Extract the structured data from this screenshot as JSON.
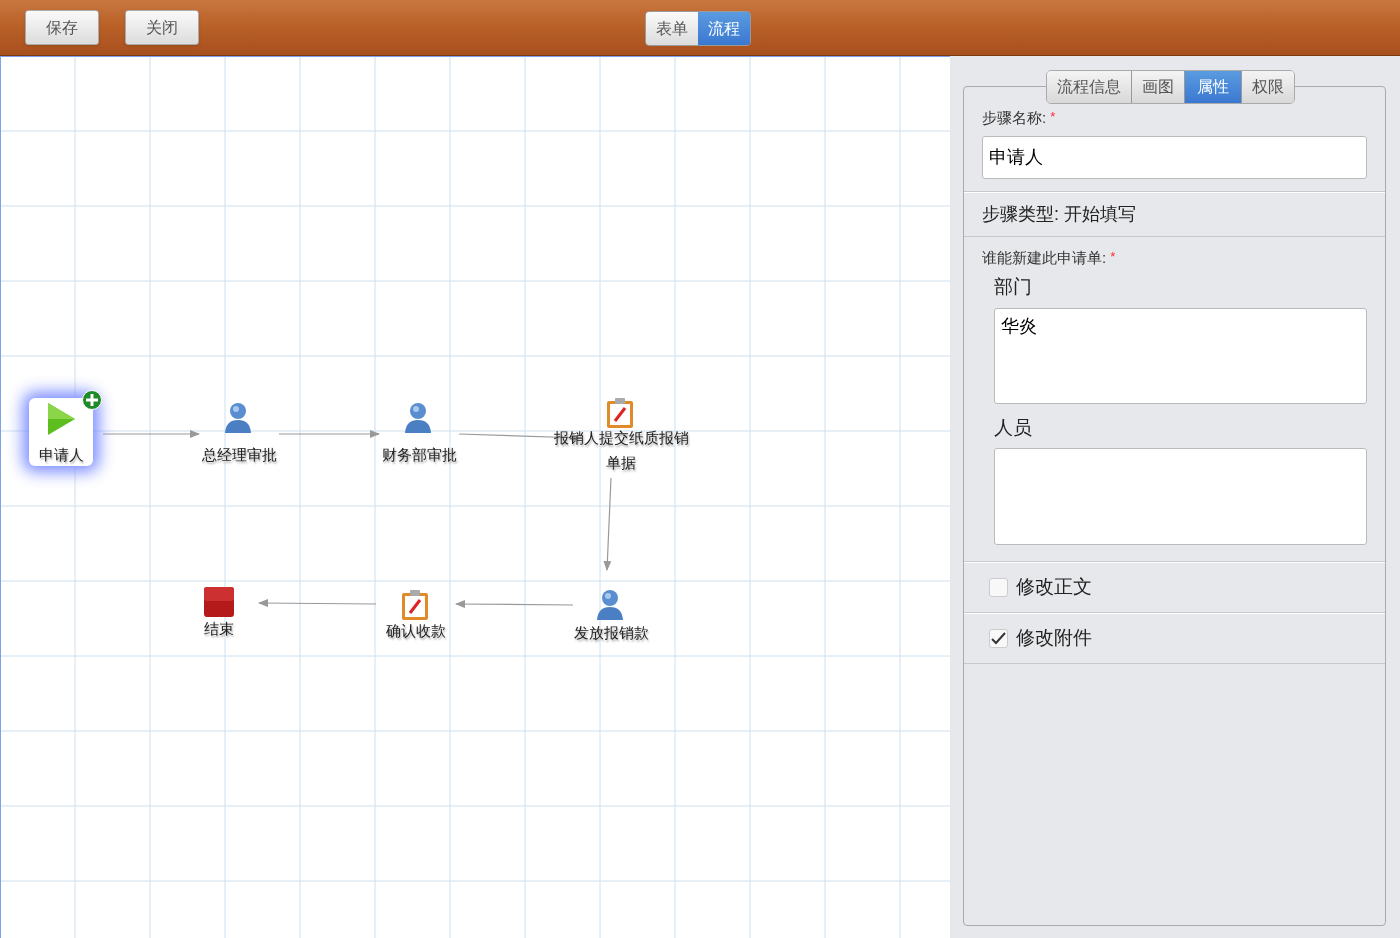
{
  "toolbar": {
    "buttons": [
      "保存",
      "关闭"
    ],
    "view_tabs": [
      {
        "label": "表单",
        "selected": false
      },
      {
        "label": "流程",
        "selected": true
      }
    ]
  },
  "flow": {
    "nodes": [
      {
        "kind": "start",
        "label": "申请人",
        "selected": true
      },
      {
        "kind": "user",
        "label": "总经理审批",
        "selected": false
      },
      {
        "kind": "user",
        "label": "财务部审批",
        "selected": false
      },
      {
        "kind": "task",
        "label": "报销人提交纸质报销单据",
        "selected": false
      },
      {
        "kind": "end",
        "label": "结束",
        "selected": false
      },
      {
        "kind": "task",
        "label": "确认收款",
        "selected": false
      },
      {
        "kind": "user",
        "label": "发放报销款",
        "selected": false
      }
    ]
  },
  "panel": {
    "tabs": [
      {
        "label": "流程信息",
        "selected": false
      },
      {
        "label": "画图",
        "selected": false
      },
      {
        "label": "属性",
        "selected": true
      },
      {
        "label": "权限",
        "selected": false
      }
    ],
    "step_name_label": "步骤名称:",
    "required_mark": "*",
    "step_name": "申请人",
    "step_type": "步骤类型: 开始填写",
    "creators_label": "谁能新建此申请单:",
    "creators_required_mark": "*",
    "department_label": "部门",
    "department_value": "华炎",
    "people_label": "人员",
    "options": [
      {
        "label": "修改正文",
        "checked": false
      },
      {
        "label": "修改附件",
        "checked": true
      }
    ]
  }
}
